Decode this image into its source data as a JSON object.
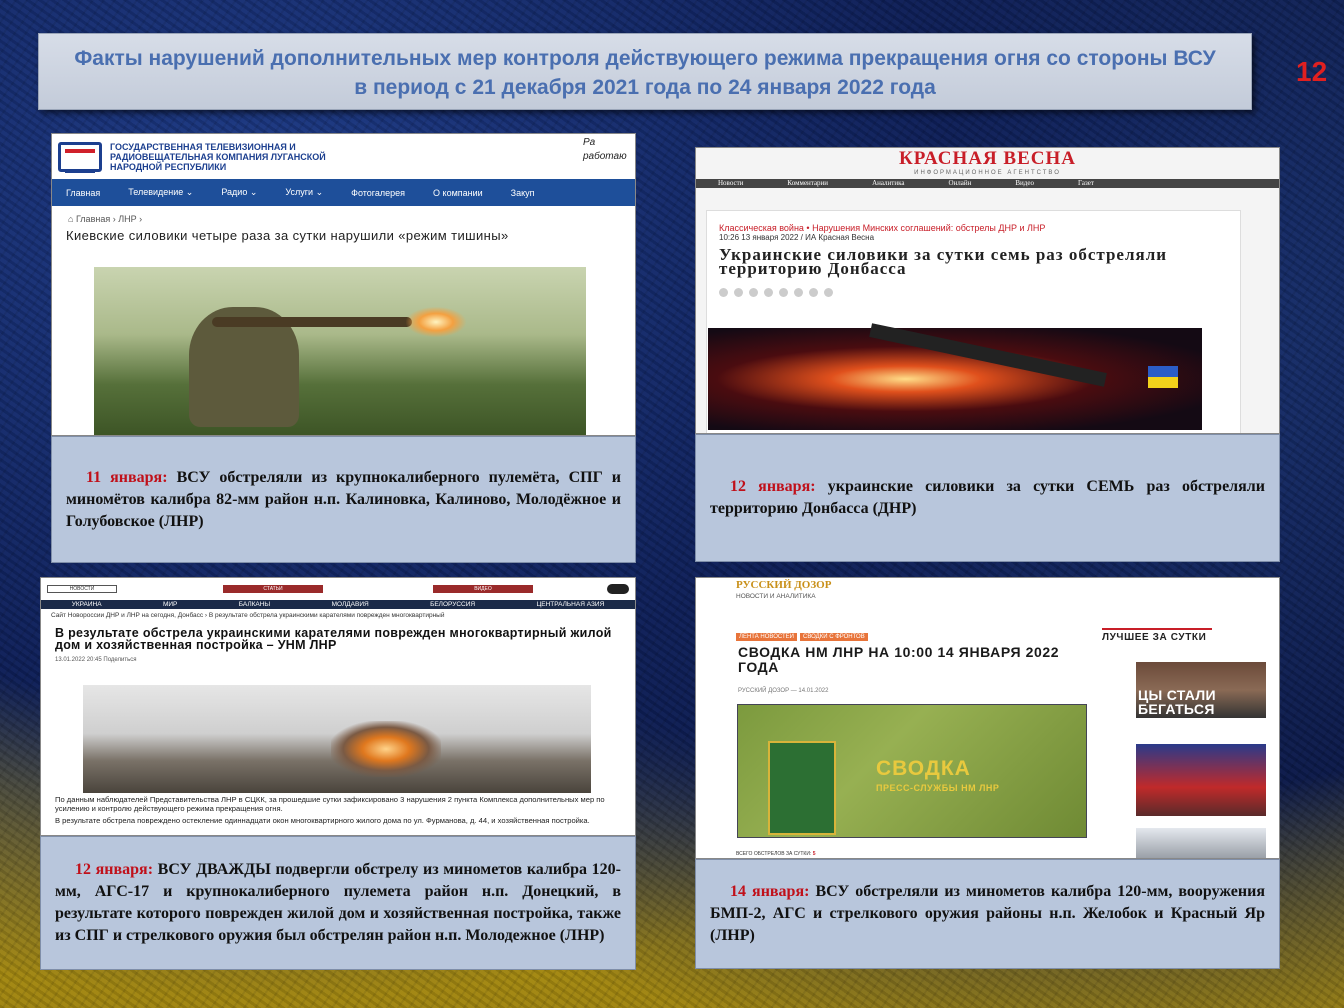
{
  "header": {
    "title_line1": "Факты нарушений дополнительных мер контроля действующего режима прекращения огня со стороны ВСУ",
    "title_line2": "в период с 21 декабря 2021 года по 24 января 2022 года",
    "page_number": "12"
  },
  "panel1": {
    "org": "ГОСУДАРСТВЕННАЯ ТЕЛЕВИЗИОННАЯ И РАДИОВЕЩАТЕЛЬНАЯ КОМПАНИЯ ЛУГАНСКОЙ НАРОДНОЙ РЕСПУБЛИКИ",
    "corner": "Ра работаю",
    "nav": [
      "Главная",
      "Телевидение ⌄",
      "Радио ⌄",
      "Услуги ⌄",
      "Фотогалерея",
      "О компании",
      "Закуп"
    ],
    "breadcrumb": "Главная ›  ЛНР ›",
    "headline": "Киевские силовики четыре раза за сутки нарушили «режим тишины»",
    "caption_date": "11 января:",
    "caption_text": " ВСУ обстреляли из крупнокалиберного пулемёта, СПГ и миномётов калибра 82-мм район н.п. Калиновка, Калиново, Молодёжное и Голубовское (ЛНР)"
  },
  "panel2": {
    "brand": "КРАСНАЯ ВЕСНА",
    "brand_sub": "ИНФОРМАЦИОННОЕ АГЕНТСТВО",
    "nav": [
      "Новости",
      "Комментарии",
      "Аналитика",
      "Онлайн",
      "Видео",
      "Газет"
    ],
    "tag": "Классическая война • Нарушения Минских соглашений: обстрелы ДНР и ЛНР",
    "meta": "10:26  13 января 2022 / ИА Красная Весна",
    "headline": "Украинские силовики за сутки семь раз обстреляли территорию Донбасса",
    "caption_date": "12 января:",
    "caption_text": " украинские силовики за сутки СЕМЬ раз обстреляли территорию Донбасса (ДНР)"
  },
  "panel3": {
    "top_news": "НОВОСТИ",
    "top_articles": "СТАТЬИ",
    "top_video": "ВИДЕО",
    "nav": [
      "УКРАИНА",
      "МИР",
      "БАЛКАНЫ",
      "МОЛДАВИЯ",
      "БЕЛОРУССИЯ",
      "ЦЕНТРАЛЬНАЯ АЗИЯ"
    ],
    "breadcrumb": "Сайт Новороссии ДНР и ЛНР на сегодня, Донбасс › В результате обстрела украинскими карателями поврежден многоквартирный",
    "headline": "В результате обстрела украинскими карателями поврежден многоквартирный жилой дом и хозяйственная постройка – УНМ ЛНР",
    "meta": "13.01.2022 20:45                    Поделиться",
    "body1": "По данным наблюдателей Представительства ЛНР в СЦКК, за прошедшие сутки зафиксировано 3 нарушения 2 пункта Комплекса дополнительных мер по усилению и контролю действующего режима прекращения огня.",
    "body2": "В результате обстрела повреждено остекление одиннадцати окон многоквартирного жилого дома по ул. Фурманова, д. 44, и хозяйственная постройка.",
    "caption_date": "12 января:",
    "caption_text": " ВСУ ДВАЖДЫ подвергли обстрелу из минометов калибра 120-мм, АГС-17 и крупнокалиберного пулемета район н.п. Донецкий, в результате которого поврежден жилой дом и хозяйственная постройка, также из СПГ и стрелкового оружия был обстрелян район н.п. Молодежное (ЛНР)"
  },
  "panel4": {
    "logo": "РУССКИЙ ДОЗОР",
    "logo_sub": "НОВОСТИ И АНАЛИТИКА",
    "tags": [
      "ЛЕНТА НОВОСТЕЙ",
      "СВОДКИ С ФРОНТОВ"
    ],
    "headline": "СВОДКА НМ ЛНР НА 10:00 14 ЯНВАРЯ 2022 ГОДА",
    "meta": "РУССКИЙ ДОЗОР — 14.01.2022",
    "img_title": "СВОДКА",
    "img_sub": "ПРЕСС-СЛУЖБЫ НМ ЛНР",
    "footer_label": "ВСЕГО ОБСТРЕЛОВ ЗА СУТКИ:",
    "footer_value": "5",
    "side_title": "ЛУЧШЕЕ ЗА СУТКИ",
    "side_img_text": "ЦЫ СТАЛИ БЕГАТЬСЯ",
    "caption_date": "14 января:",
    "caption_text": " ВСУ обстреляли из минометов калибра 120-мм, вооружения БМП-2, АГС и стрелкового оружия районы н.п. Желобок и Красный Яр (ЛНР)"
  }
}
